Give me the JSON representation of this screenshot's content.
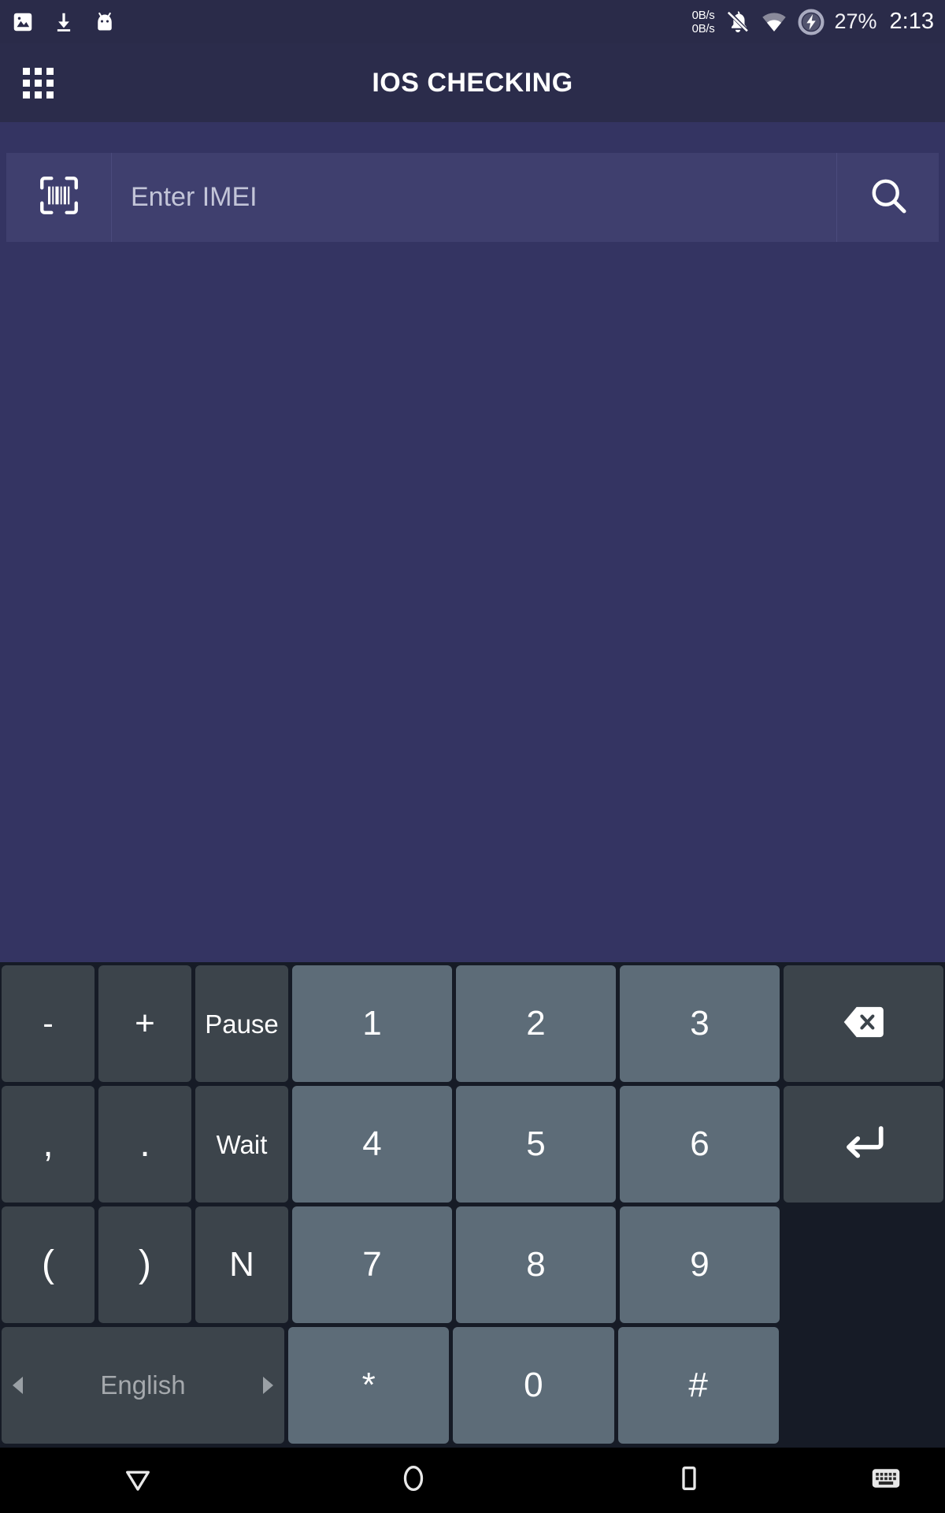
{
  "status_bar": {
    "left_icons": [
      "image-icon",
      "download-icon",
      "android-head-icon"
    ],
    "network_speed_up": "0B/s",
    "network_speed_down": "0B/s",
    "right_icons": [
      "bell-off-icon",
      "wifi-icon",
      "battery-charging-icon"
    ],
    "battery_percent": "27%",
    "clock": "2:13"
  },
  "app_bar": {
    "menu_icon": "grid-menu-icon",
    "title": "IOS CHECKING"
  },
  "search": {
    "scan_icon": "barcode-scan-icon",
    "placeholder": "Enter IMEI",
    "value": "",
    "search_icon": "search-icon"
  },
  "keyboard": {
    "language": "English",
    "rows": [
      [
        {
          "label": "-",
          "type": "fn",
          "width": "narrow",
          "name": "key-minus"
        },
        {
          "label": "+",
          "type": "fn",
          "width": "narrow",
          "name": "key-plus"
        },
        {
          "label": "Pause",
          "type": "fn",
          "width": "narrow",
          "name": "key-pause"
        },
        {
          "label": "1",
          "type": "num",
          "width": "wide",
          "name": "key-1"
        },
        {
          "label": "2",
          "type": "num",
          "width": "wide",
          "name": "key-2"
        },
        {
          "label": "3",
          "type": "num",
          "width": "wide",
          "name": "key-3"
        },
        {
          "label": "",
          "type": "fn",
          "width": "wide",
          "name": "key-backspace",
          "icon": "backspace-icon"
        }
      ],
      [
        {
          "label": ",",
          "type": "fn",
          "width": "narrow",
          "name": "key-comma"
        },
        {
          "label": ".",
          "type": "fn",
          "width": "narrow",
          "name": "key-period"
        },
        {
          "label": "Wait",
          "type": "fn",
          "width": "narrow",
          "name": "key-wait"
        },
        {
          "label": "4",
          "type": "num",
          "width": "wide",
          "name": "key-4"
        },
        {
          "label": "5",
          "type": "num",
          "width": "wide",
          "name": "key-5"
        },
        {
          "label": "6",
          "type": "num",
          "width": "wide",
          "name": "key-6"
        },
        {
          "label": "",
          "type": "fn",
          "width": "wide",
          "name": "key-enter",
          "icon": "enter-icon"
        }
      ],
      [
        {
          "label": "(",
          "type": "fn",
          "width": "narrow",
          "name": "key-paren-open"
        },
        {
          "label": ")",
          "type": "fn",
          "width": "narrow",
          "name": "key-paren-close"
        },
        {
          "label": "N",
          "type": "fn",
          "width": "narrow",
          "name": "key-n"
        },
        {
          "label": "7",
          "type": "num",
          "width": "wide",
          "name": "key-7"
        },
        {
          "label": "8",
          "type": "num",
          "width": "wide",
          "name": "key-8"
        },
        {
          "label": "9",
          "type": "num",
          "width": "wide",
          "name": "key-9"
        },
        {
          "label": "",
          "type": "blank",
          "width": "wide",
          "name": "key-empty-1"
        }
      ],
      [
        {
          "label": "English",
          "type": "space",
          "width": "space",
          "name": "key-language-space"
        },
        {
          "label": "*",
          "type": "num",
          "width": "wide",
          "name": "key-asterisk"
        },
        {
          "label": "0",
          "type": "num",
          "width": "wide",
          "name": "key-0"
        },
        {
          "label": "#",
          "type": "num",
          "width": "wide",
          "name": "key-hash"
        },
        {
          "label": "",
          "type": "blank",
          "width": "wide",
          "name": "key-empty-2"
        }
      ]
    ]
  },
  "nav_bar": {
    "back_icon": "back-triangle-icon",
    "home_icon": "home-circle-icon",
    "recents_icon": "recents-square-icon",
    "keyboard_icon": "hide-keyboard-icon"
  },
  "colors": {
    "status_bar_bg": "#2a2b49",
    "app_bar_bg": "#2b2c4b",
    "search_bg": "#3f3f6e",
    "body_bg": "#343462",
    "keyboard_bg": "#161b26",
    "key_fn_bg": "#3c444b",
    "key_num_bg": "#5d6c78",
    "nav_bg": "#000000"
  }
}
